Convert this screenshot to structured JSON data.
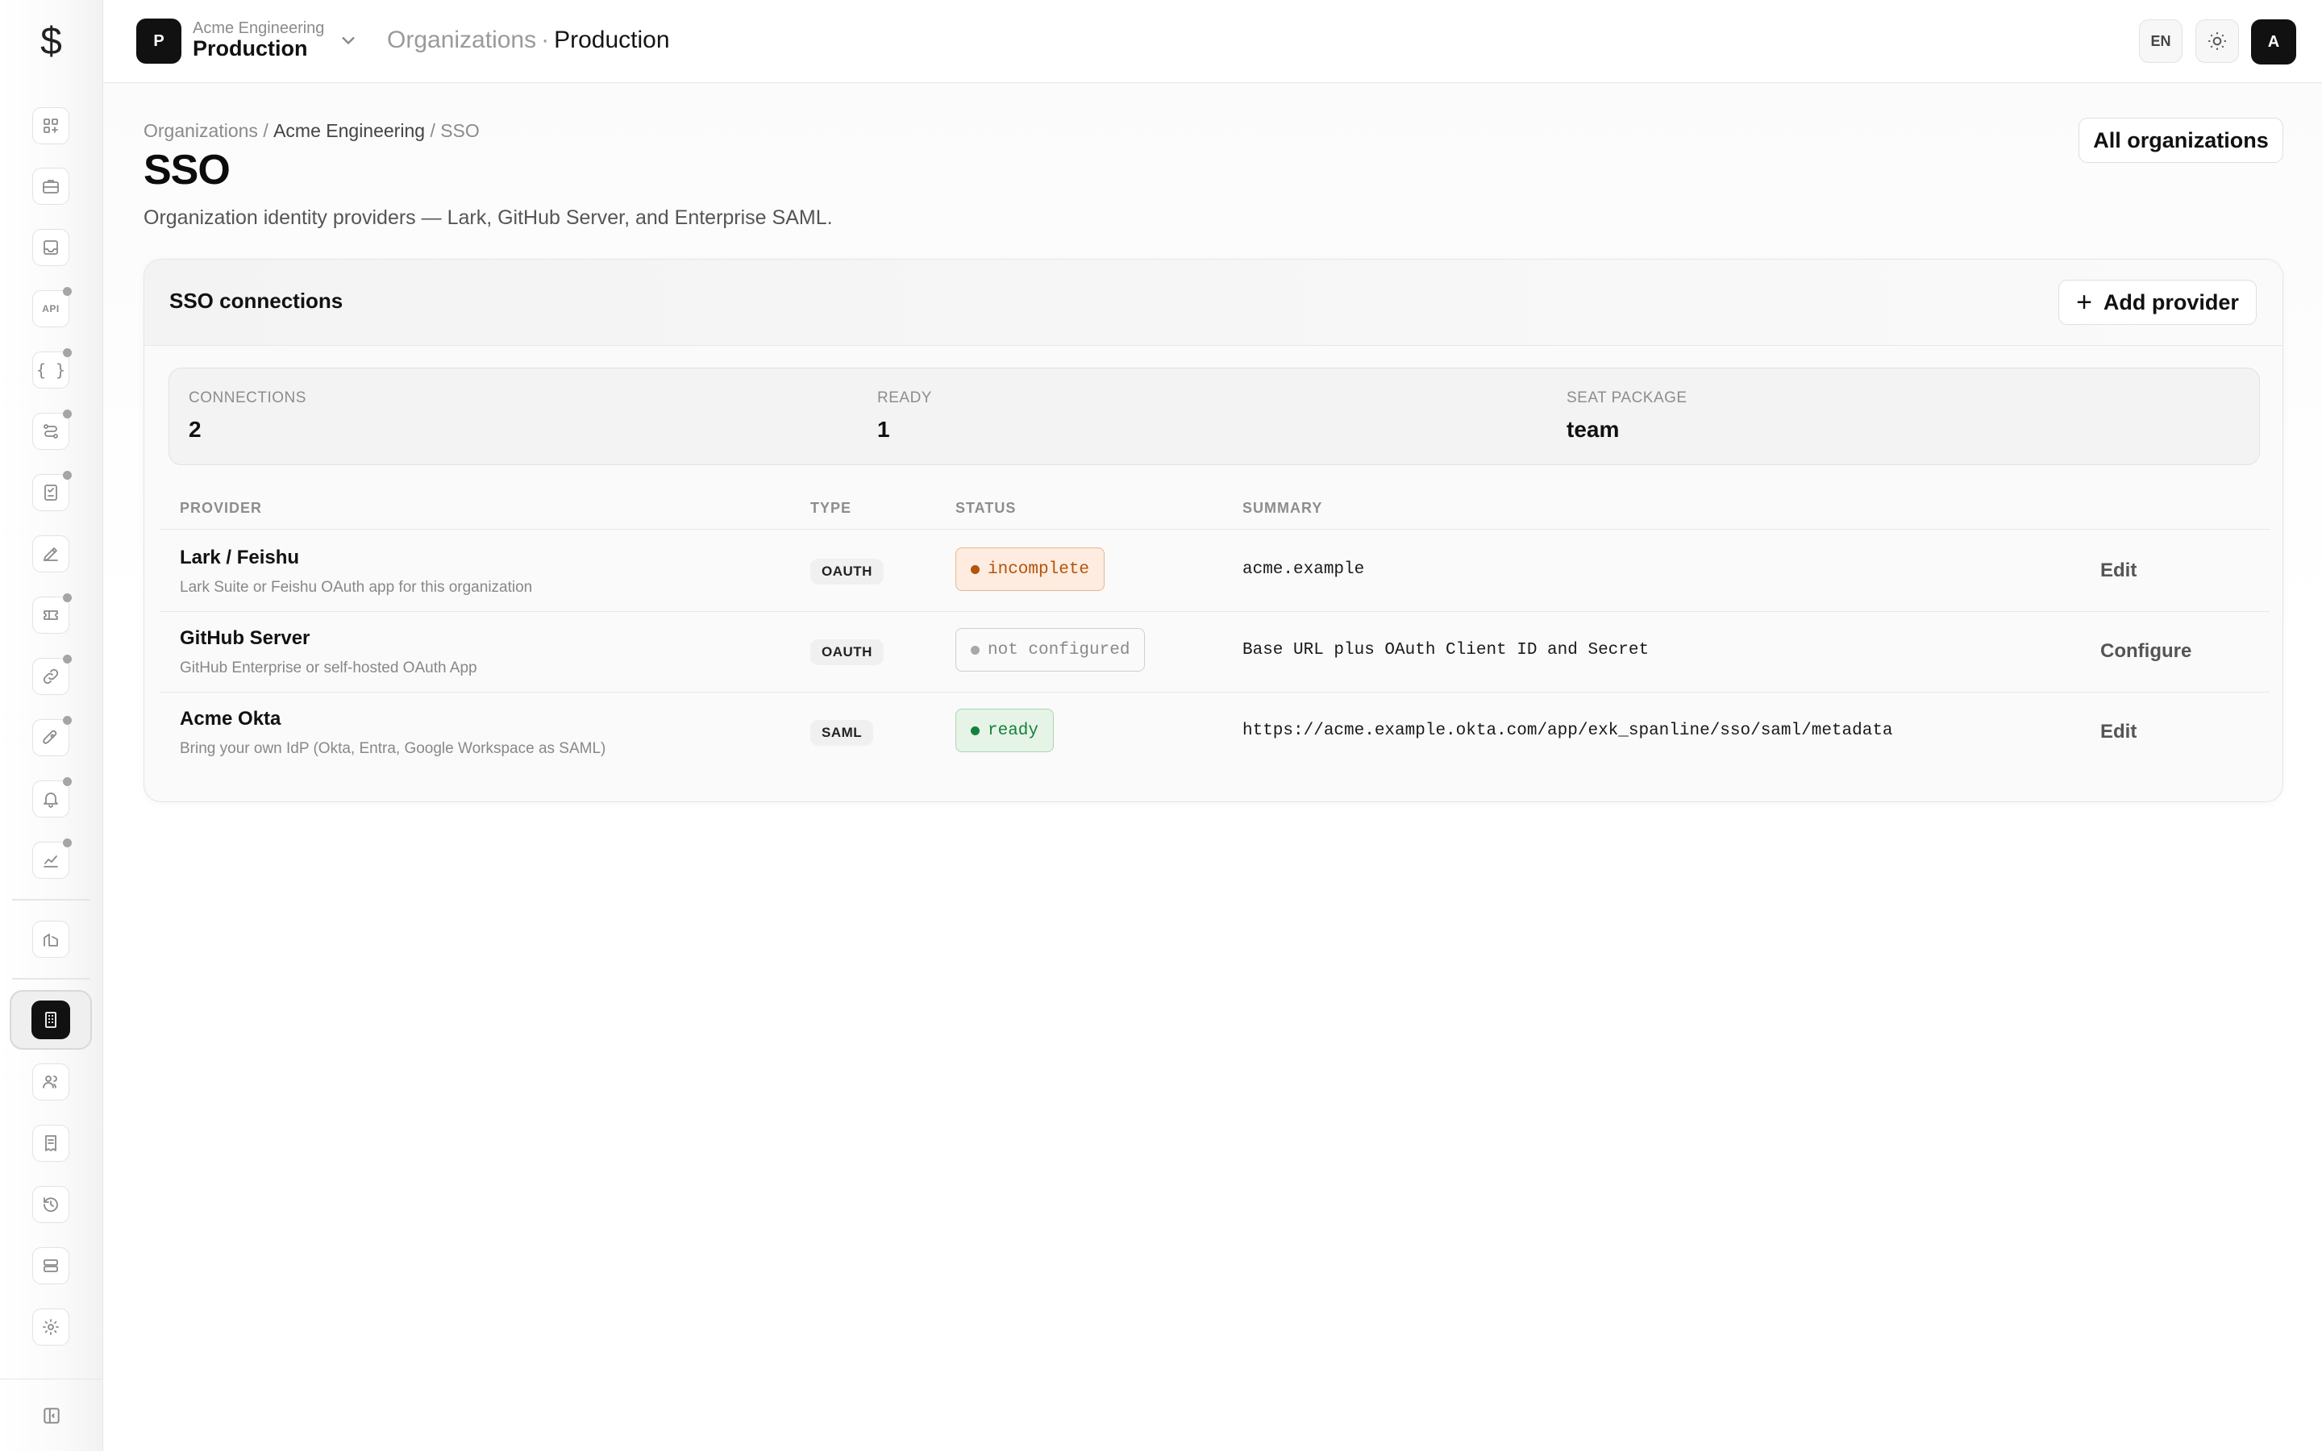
{
  "app": {
    "logo_glyph": "$"
  },
  "header": {
    "project_initial": "P",
    "project_org": "Acme Engineering",
    "project_name": "Production",
    "crumb_parent": "Organizations",
    "crumb_sep": "·",
    "crumb_current": "Production",
    "lang_label": "EN",
    "avatar_initial": "A"
  },
  "sidebar": {
    "items": [
      {
        "name": "dashboard-icon"
      },
      {
        "name": "briefcase-icon"
      },
      {
        "name": "inbox-icon"
      },
      {
        "name": "api-icon",
        "label": "API"
      },
      {
        "name": "braces-icon",
        "label": "{ }"
      },
      {
        "name": "workflow-icon"
      },
      {
        "name": "checklist-icon"
      },
      {
        "name": "pen-tool-icon"
      },
      {
        "name": "ticket-icon"
      },
      {
        "name": "link-icon"
      },
      {
        "name": "rocket-icon"
      },
      {
        "name": "bell-icon"
      },
      {
        "name": "chart-icon"
      },
      {
        "name": "buildings-icon"
      },
      {
        "name": "organization-icon"
      },
      {
        "name": "users-icon"
      },
      {
        "name": "receipt-icon"
      },
      {
        "name": "history-icon"
      },
      {
        "name": "storage-icon"
      },
      {
        "name": "settings-icon"
      },
      {
        "name": "collapse-sidebar-icon"
      }
    ]
  },
  "page": {
    "breadcrumb_root": "Organizations",
    "breadcrumb_sep": "/",
    "breadcrumb_org": "Acme Engineering",
    "breadcrumb_current": "SSO",
    "title": "SSO",
    "subtitle": "Organization identity providers — Lark, GitHub Server, and Enterprise SAML.",
    "all_orgs_label": "All organizations"
  },
  "card": {
    "title": "SSO connections",
    "add_label": "Add provider",
    "add_glyph": "+",
    "stats": [
      {
        "label": "CONNECTIONS",
        "value": "2"
      },
      {
        "label": "READY",
        "value": "1"
      },
      {
        "label": "SEAT PACKAGE",
        "value": "team"
      }
    ],
    "columns": {
      "provider": "PROVIDER",
      "type": "TYPE",
      "status": "STATUS",
      "summary": "SUMMARY"
    },
    "rows": [
      {
        "name": "Lark / Feishu",
        "desc": "Lark Suite or Feishu OAuth app for this organization",
        "type": "OAUTH",
        "status": "incomplete",
        "summary": "acme.example",
        "action": "Edit"
      },
      {
        "name": "GitHub Server",
        "desc": "GitHub Enterprise or self-hosted OAuth App",
        "type": "OAUTH",
        "status": "not configured",
        "summary": "Base URL plus OAuth Client ID and Secret",
        "action": "Configure"
      },
      {
        "name": "Acme Okta",
        "desc": "Bring your own IdP (Okta, Entra, Google Workspace as SAML)",
        "type": "SAML",
        "status": "ready",
        "summary": "https://acme.example.okta.com/app/exk_spanline/sso/saml/metadata",
        "action": "Edit"
      }
    ]
  },
  "colors": {
    "status_incomplete": "#b45309",
    "status_incomplete_bg": "#fdecdf",
    "status_not_configured": "#8a8a8a",
    "status_ready": "#15803d",
    "status_ready_bg": "#e5f4e7"
  }
}
